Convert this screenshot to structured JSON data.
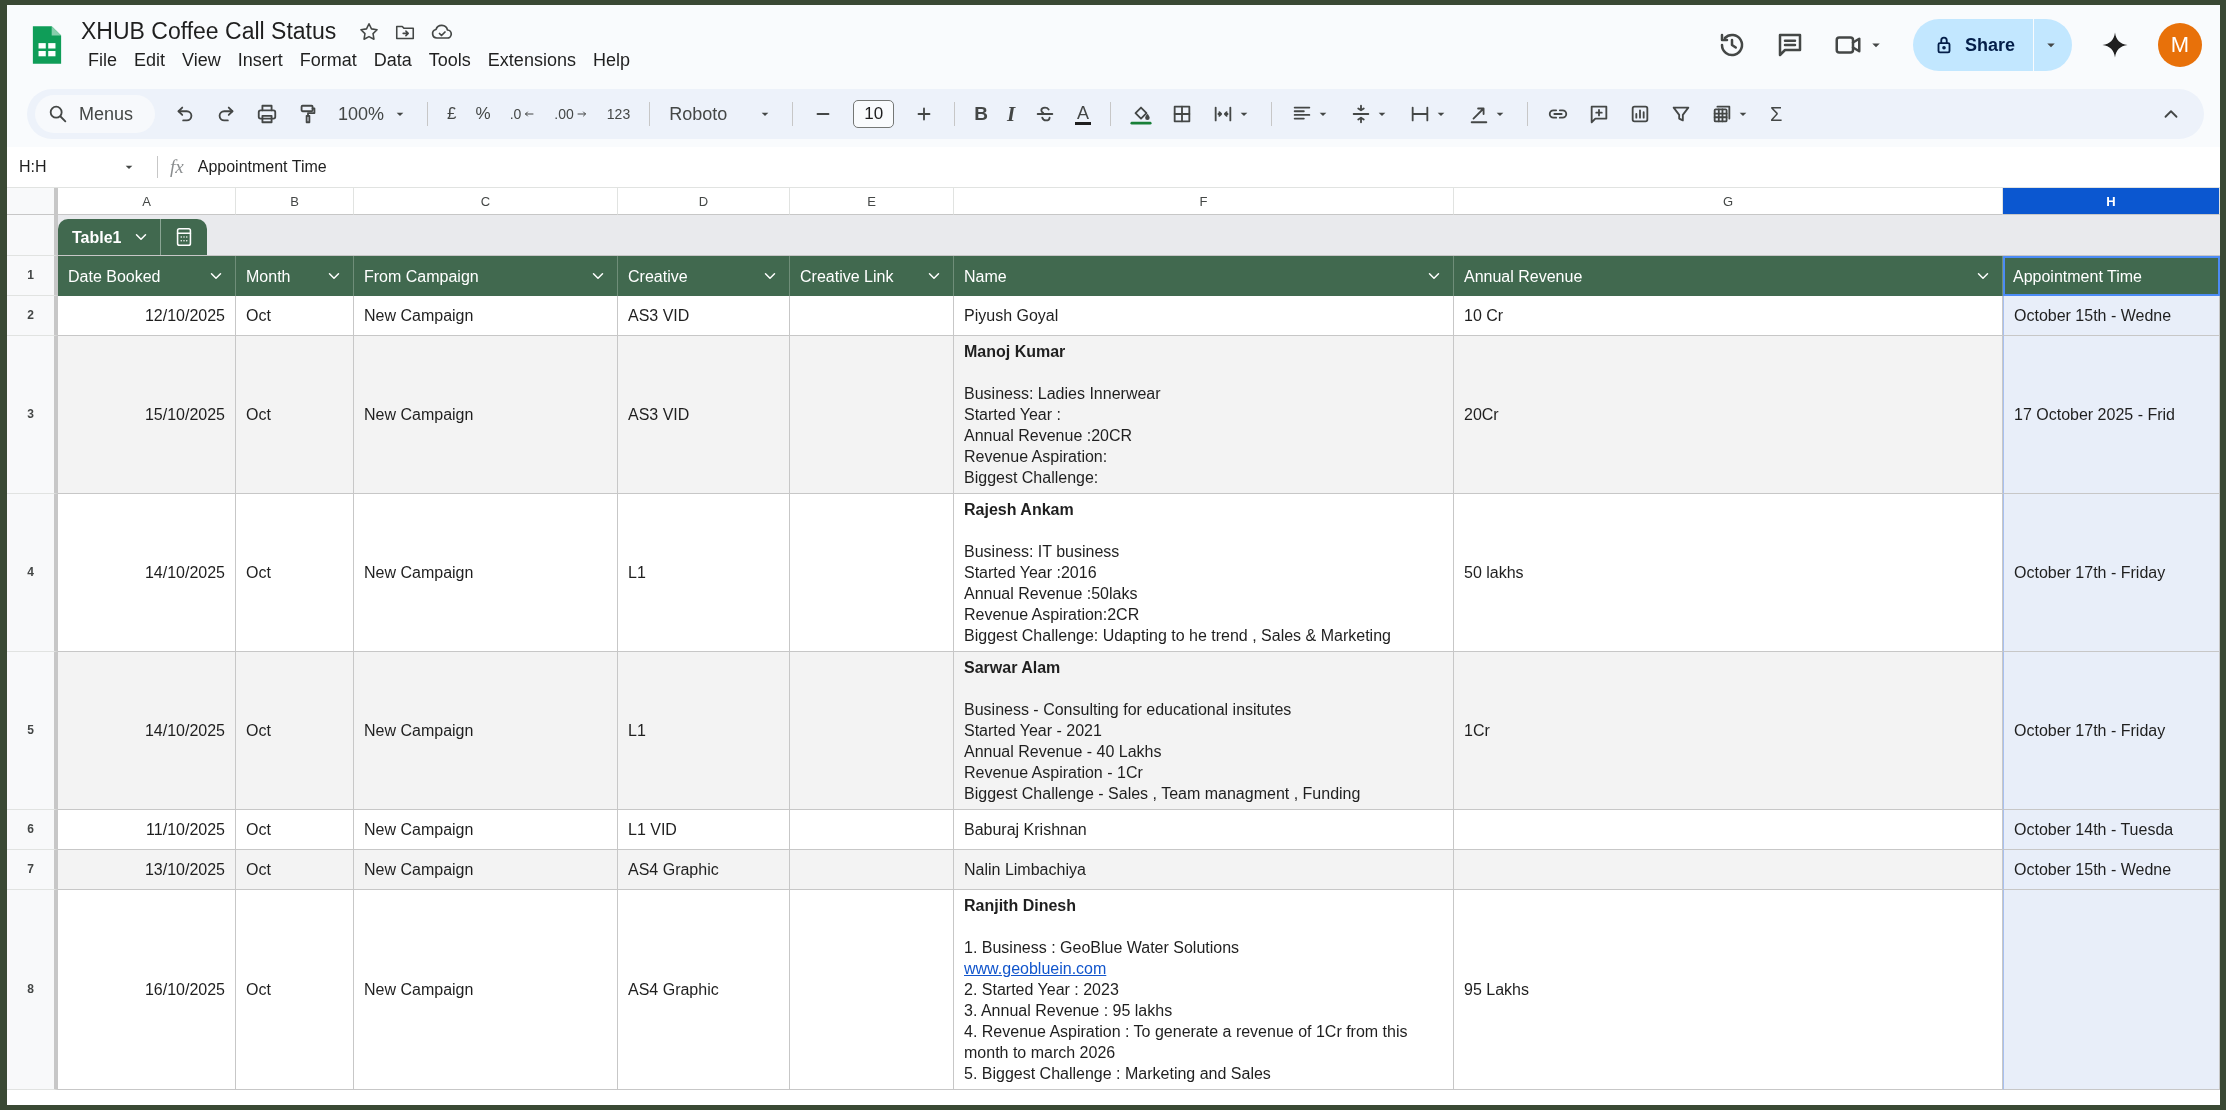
{
  "document": {
    "title": "XHUB Coffee Call Status"
  },
  "menu": [
    "File",
    "Edit",
    "View",
    "Insert",
    "Format",
    "Data",
    "Tools",
    "Extensions",
    "Help"
  ],
  "share_button": {
    "label": "Share"
  },
  "account": {
    "initial": "M"
  },
  "toolbar": {
    "search_label": "Menus",
    "zoom": "100%",
    "currency": "£",
    "percent": "%",
    "decrease_decimals": ".0",
    "increase_decimals": ".00",
    "number_format": "123",
    "font": "Roboto",
    "font_size": "10",
    "bold": "B",
    "italic": "I",
    "text_color": "A",
    "sum": "Σ"
  },
  "formula_bar": {
    "name_box": "H:H",
    "fx": "fx",
    "content": "Appointment Time"
  },
  "table": {
    "name": "Table1",
    "header_row_number": "1"
  },
  "columns": [
    {
      "letter": "A",
      "header": "Date Booked",
      "filter": true,
      "selected": false
    },
    {
      "letter": "B",
      "header": "Month",
      "filter": true,
      "selected": false
    },
    {
      "letter": "C",
      "header": "From Campaign",
      "filter": true,
      "selected": false
    },
    {
      "letter": "D",
      "header": "Creative",
      "filter": true,
      "selected": false
    },
    {
      "letter": "E",
      "header": "Creative Link",
      "filter": true,
      "selected": false
    },
    {
      "letter": "F",
      "header": "Name",
      "filter": true,
      "selected": false
    },
    {
      "letter": "G",
      "header": "Annual Revenue",
      "filter": true,
      "selected": false
    },
    {
      "letter": "H",
      "header": "Appointment Time",
      "filter": false,
      "selected": true
    }
  ],
  "rows": [
    {
      "number": "2",
      "cells": {
        "A": "12/10/2025",
        "B": "Oct",
        "C": "New Campaign",
        "D": "AS3 VID",
        "F": "Piyush Goyal",
        "G": "10 Cr",
        "H": "October 15th - Wedne"
      }
    },
    {
      "number": "3",
      "cells": {
        "A": "15/10/2025",
        "B": "Oct",
        "C": "New Campaign",
        "D": "AS3 VID",
        "F": {
          "name": "Manoj Kumar",
          "details": [
            "Business: Ladies Innerwear",
            "Started Year :",
            "Annual Revenue :20CR",
            "Revenue Aspiration:",
            "Biggest Challenge:"
          ]
        },
        "G": "20Cr",
        "H": "17 October 2025 - Frid"
      }
    },
    {
      "number": "4",
      "cells": {
        "A": "14/10/2025",
        "B": "Oct",
        "C": "New Campaign",
        "D": "L1",
        "F": {
          "name": "Rajesh Ankam",
          "details": [
            "Business: IT business",
            "Started Year :2016",
            "Annual Revenue :50laks",
            "Revenue Aspiration:2CR",
            "Biggest Challenge: Udapting to he trend , Sales & Marketing"
          ]
        },
        "G": "50 lakhs",
        "H": "October 17th - Friday"
      }
    },
    {
      "number": "5",
      "cells": {
        "A": "14/10/2025",
        "B": "Oct",
        "C": "New Campaign",
        "D": "L1",
        "F": {
          "name": "Sarwar Alam",
          "details": [
            "Business - Consulting for educational insitutes",
            "Started Year - 2021",
            "Annual Revenue - 40 Lakhs",
            "Revenue Aspiration - 1Cr",
            "Biggest Challenge - Sales , Team managment , Funding"
          ]
        },
        "G": "1Cr",
        "H": "October 17th - Friday"
      }
    },
    {
      "number": "6",
      "cells": {
        "A": "11/10/2025",
        "B": "Oct",
        "C": "New Campaign",
        "D": "L1 VID",
        "F": "Baburaj Krishnan",
        "H": "October 14th - Tuesda"
      }
    },
    {
      "number": "7",
      "cells": {
        "A": "13/10/2025",
        "B": "Oct",
        "C": "New Campaign",
        "D": "AS4 Graphic",
        "F": "Nalin Limbachiya",
        "H": "October 15th - Wedne"
      }
    },
    {
      "number": "8",
      "cells": {
        "A": "16/10/2025",
        "B": "Oct",
        "C": "New Campaign",
        "D": "AS4 Graphic",
        "F": {
          "name": "Ranjith Dinesh",
          "details": [
            "1. Business : GeoBlue Water Solutions",
            {
              "text": "www.geobluein.com",
              "kind": "link"
            },
            "2. Started Year : 2023",
            "3. Annual Revenue : 95 lakhs",
            "4. Revenue Aspiration : To generate a revenue of 1Cr from this month to march 2026",
            "5. Biggest Challenge : Marketing and Sales"
          ]
        },
        "G": "95 Lakhs"
      }
    }
  ]
}
